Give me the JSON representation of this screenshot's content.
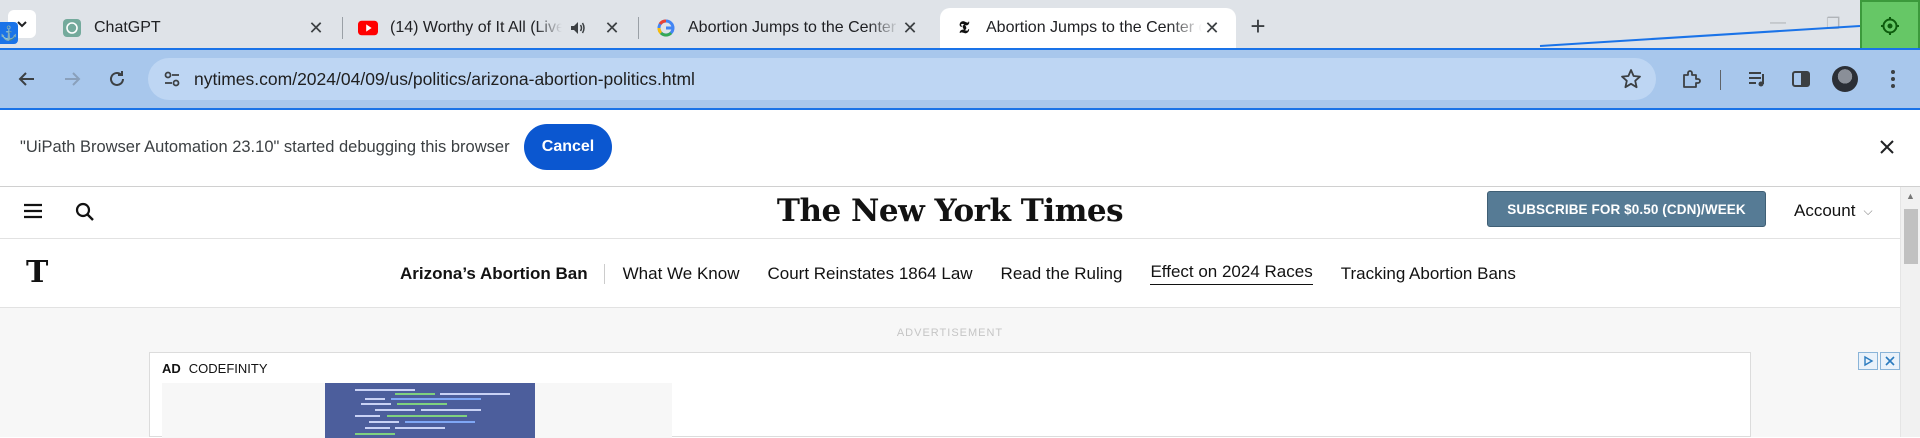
{
  "browser": {
    "tabs": [
      {
        "title": "ChatGPT",
        "favicon": "chatgpt-icon",
        "active": false
      },
      {
        "title": "(14) Worthy of It All (Live) |",
        "favicon": "youtube-icon",
        "audio": true,
        "active": false
      },
      {
        "title": "Abortion Jumps to the Center o",
        "favicon": "google-icon",
        "active": false
      },
      {
        "title": "Abortion Jumps to the Center o",
        "favicon": "nyt-icon",
        "active": true
      }
    ],
    "url": "nytimes.com/2024/04/09/us/politics/arizona-abortion-politics.html",
    "accent_color": "#1a73e8",
    "extension_color": "#66c766"
  },
  "infobar": {
    "message": "\"UiPath Browser Automation 23.10\" started debugging this browser",
    "cancel_label": "Cancel"
  },
  "nyt": {
    "logo": "The New York Times",
    "logo_short": "T",
    "subscribe_label": "SUBSCRIBE FOR $0.50 (CDN)/WEEK",
    "account_label": "Account",
    "subnav": {
      "title": "Arizona’s Abortion Ban",
      "items": [
        "What We Know",
        "Court Reinstates 1864 Law",
        "Read the Ruling",
        "Effect on 2024 Races",
        "Tracking Abortion Bans"
      ]
    },
    "ad": {
      "label": "ADVERTISEMENT",
      "tag": "AD",
      "sponsor": "CODEFINITY"
    }
  }
}
